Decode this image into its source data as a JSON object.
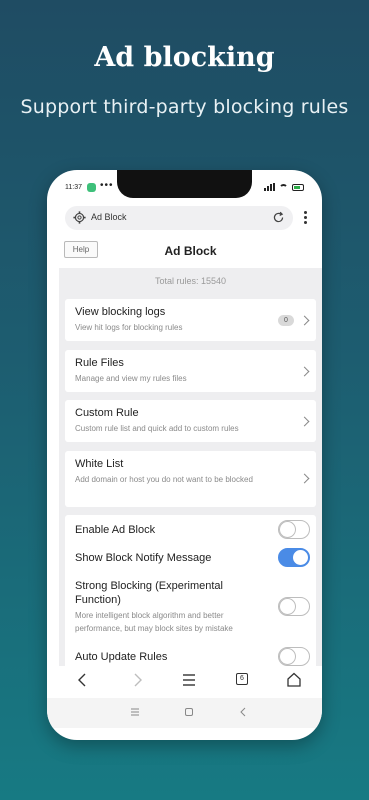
{
  "hero": {
    "title": "Ad blocking",
    "subtitle": "Support third-party blocking rules"
  },
  "status_bar": {
    "time": "11:37",
    "dots": "•••"
  },
  "url_bar": {
    "text": "Ad Block",
    "left_icon": "gear-icon",
    "right_icon": "reload-icon"
  },
  "page": {
    "help_label": "Help",
    "title": "Ad Block",
    "total_rules": "Total rules: 15540"
  },
  "items": [
    {
      "title": "View blocking logs",
      "subtitle": "View hit logs for blocking rules",
      "badge": "0"
    },
    {
      "title": "Rule Files",
      "subtitle": "Manage and view my rules files"
    },
    {
      "title": "Custom Rule",
      "subtitle": "Custom rule list and quick add to custom rules"
    },
    {
      "title": "White List",
      "subtitle": "Add domain or host you do not want to be blocked"
    }
  ],
  "settings": [
    {
      "title": "Enable Ad Block",
      "on": false
    },
    {
      "title": "Show Block Notify Message",
      "on": true
    },
    {
      "title": "Strong Blocking (Experimental Function)",
      "subtitle": "More intelligent block algorithm and better performance, but may block sites by mistake",
      "on": false
    },
    {
      "title": "Auto Update Rules",
      "on": false
    }
  ],
  "bottom_nav": {
    "tabs_count": "6",
    "icons": [
      "back-icon",
      "forward-icon",
      "menu-icon",
      "tabs-icon",
      "home-icon"
    ]
  },
  "colors": {
    "accent": "#4a8be6",
    "background_top": "#1f4c63",
    "background_bottom": "#177a83"
  }
}
